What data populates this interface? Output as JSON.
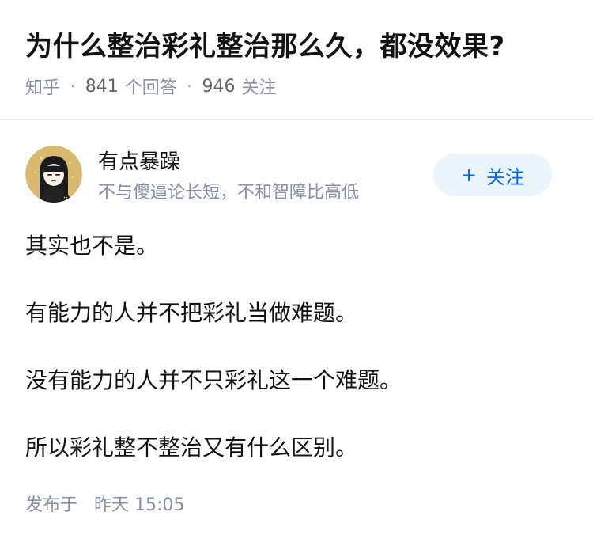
{
  "question": {
    "title": "为什么整治彩礼整治那么久，都没效果?",
    "source": "知乎",
    "answers_count": "841",
    "answers_label": "个回答",
    "followers_count": "946",
    "followers_label": "关注"
  },
  "author": {
    "name": "有点暴躁",
    "bio": "不与傻逼论长短，不和智障比高低",
    "avatar_icon": "avatar-cartoon-girl",
    "follow_label": "关注",
    "follow_icon": "plus-icon",
    "accent_color": "#0066ff"
  },
  "answer": {
    "paragraphs": [
      "其实也不是。",
      "有能力的人并不把彩礼当做难题。",
      "没有能力的人并不只彩礼这一个难题。",
      "所以彩礼整不整治又有什么区别。"
    ],
    "published_label": "发布于",
    "published_time": "昨天 15:05"
  }
}
